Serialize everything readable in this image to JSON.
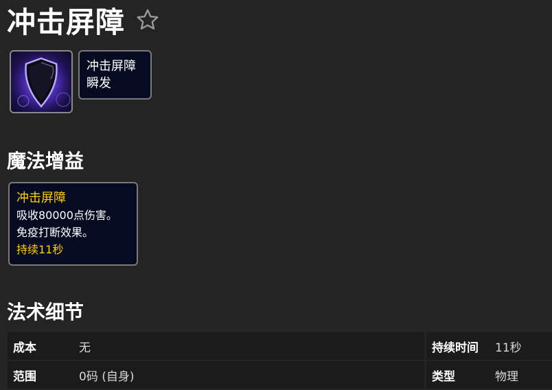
{
  "spell": {
    "name": "冲击屏障"
  },
  "icons": {
    "favorite": "star-outline-icon",
    "spell": "shield-spell-icon"
  },
  "spell_tooltip": {
    "name": "冲击屏障",
    "cast": "瞬发"
  },
  "sections": {
    "buffs": "魔法增益",
    "details": "法术细节"
  },
  "buff_tooltip": {
    "name": "冲击屏障",
    "line1": "吸收80000点伤害。",
    "line2": "免疫打断效果。",
    "duration": "持续11秒"
  },
  "details": {
    "left": [
      {
        "key": "成本",
        "value": "无"
      },
      {
        "key": "范围",
        "value": "0码 (自身)"
      }
    ],
    "right": [
      {
        "key": "持续时间",
        "value": "11秒"
      },
      {
        "key": "类型",
        "value": "物理"
      }
    ]
  },
  "colors": {
    "accent": "#ffd100",
    "background": "#242424",
    "tooltip_bg": "#070b22"
  }
}
